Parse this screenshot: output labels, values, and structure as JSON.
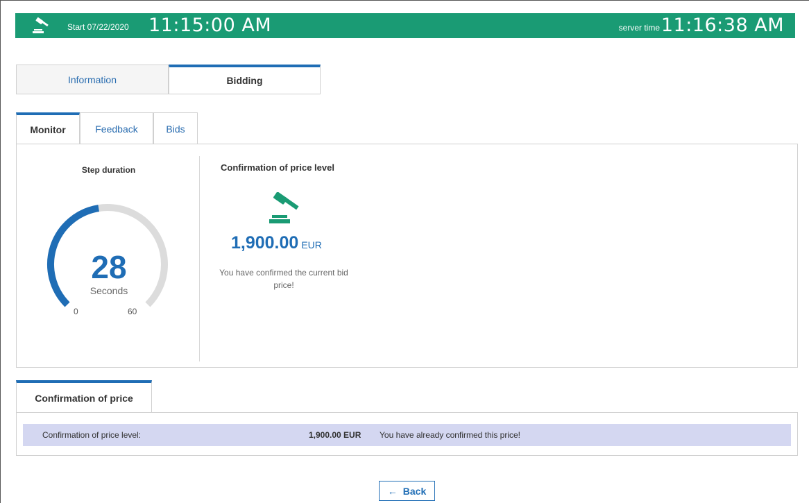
{
  "header": {
    "start_label": "Start 07/22/2020",
    "start_time": "11:15:00 AM",
    "server_label": "server time",
    "server_time": "11:16:38 AM",
    "bg_color": "#1a9b74",
    "icon": "gavel-icon"
  },
  "top_tabs": [
    {
      "label": "Information",
      "active": false
    },
    {
      "label": "Bidding",
      "active": true
    }
  ],
  "sub_tabs": [
    {
      "label": "Monitor",
      "active": true
    },
    {
      "label": "Feedback",
      "active": false
    },
    {
      "label": "Bids",
      "active": false
    }
  ],
  "monitor": {
    "step_title": "Step duration",
    "gauge": {
      "value": "28",
      "unit": "Seconds",
      "min": "0",
      "max": "60",
      "level": 28,
      "scale_max": 60,
      "color": "#1f6db5"
    },
    "confirmation": {
      "title": "Confirmation of price level",
      "price": "1,900.00",
      "currency": "EUR",
      "message": "You have confirmed the current bid price!",
      "icon": "gavel-icon"
    }
  },
  "price_confirmation": {
    "tab_label": "Confirmation of price",
    "row_label": "Confirmation of price level:",
    "row_amount": "1,900.00 EUR",
    "row_note": "You have already confirmed this price!"
  },
  "back_button": {
    "arrow": "←",
    "label": "Back"
  }
}
